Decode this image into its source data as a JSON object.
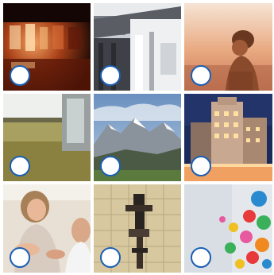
{
  "grid": {
    "tiles": [
      {
        "subject": "building-at-night",
        "selected": false
      },
      {
        "subject": "building-balcony",
        "selected": false
      },
      {
        "subject": "person-at-sunset",
        "selected": false
      },
      {
        "subject": "window-wall",
        "selected": false
      },
      {
        "subject": "mountains",
        "selected": false
      },
      {
        "subject": "hotel-building",
        "selected": false
      },
      {
        "subject": "people-meeting",
        "selected": false
      },
      {
        "subject": "wall-with-fixture",
        "selected": false
      },
      {
        "subject": "colorful-balls",
        "selected": false
      }
    ]
  },
  "colors": {
    "checkbox_border": "#1a5fb4",
    "checkbox_fill": "#ffffff"
  }
}
